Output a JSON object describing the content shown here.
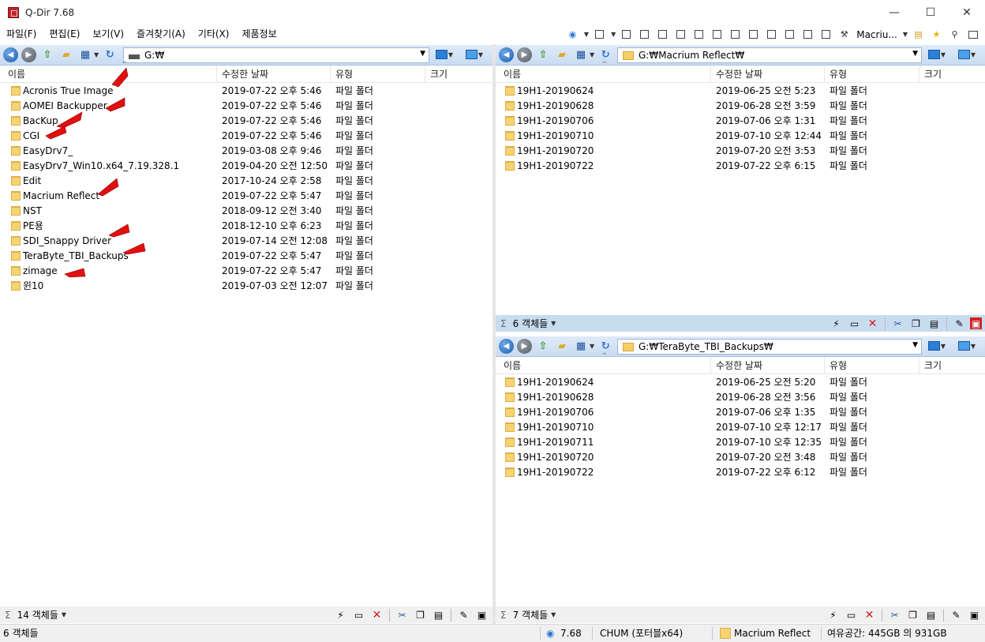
{
  "window": {
    "title": "Q-Dir 7.68"
  },
  "menu": [
    "파일(F)",
    "편집(E)",
    "보기(V)",
    "즐겨찾기(A)",
    "기타(X)",
    "제품정보"
  ],
  "toolbar_right": {
    "macro_label": "Macriu..."
  },
  "columns": {
    "name": "이름",
    "modified": "수정한 날짜",
    "type": "유형",
    "size": "크기"
  },
  "left_pane": {
    "path": "G:₩",
    "rows": [
      {
        "name": "Acronis True Image",
        "date": "2019-07-22 오후 5:46",
        "type": "파일 폴더"
      },
      {
        "name": "AOMEI Backupper",
        "date": "2019-07-22 오후 5:46",
        "type": "파일 폴더"
      },
      {
        "name": "BacKup",
        "date": "2019-07-22 오후 5:46",
        "type": "파일 폴더"
      },
      {
        "name": "CGI",
        "date": "2019-07-22 오후 5:46",
        "type": "파일 폴더"
      },
      {
        "name": "EasyDrv7_",
        "date": "2019-03-08 오후 9:46",
        "type": "파일 폴더"
      },
      {
        "name": "EasyDrv7_Win10.x64_7.19.328.1",
        "date": "2019-04-20 오전 12:50",
        "type": "파일 폴더"
      },
      {
        "name": "Edit",
        "date": "2017-10-24 오후 2:58",
        "type": "파일 폴더"
      },
      {
        "name": "Macrium Reflect",
        "date": "2019-07-22 오후 5:47",
        "type": "파일 폴더"
      },
      {
        "name": "NST",
        "date": "2018-09-12 오전 3:40",
        "type": "파일 폴더"
      },
      {
        "name": "PE용",
        "date": "2018-12-10 오후 6:23",
        "type": "파일 폴더"
      },
      {
        "name": "SDI_Snappy Driver",
        "date": "2019-07-14 오전 12:08",
        "type": "파일 폴더"
      },
      {
        "name": "TeraByte_TBI_Backups",
        "date": "2019-07-22 오후 5:47",
        "type": "파일 폴더"
      },
      {
        "name": "zimage",
        "date": "2019-07-22 오후 5:47",
        "type": "파일 폴더"
      },
      {
        "name": "윈10",
        "date": "2019-07-03 오전 12:07",
        "type": "파일 폴더"
      }
    ],
    "status": "14 객체들"
  },
  "right_top_pane": {
    "path": "G:₩Macrium Reflect₩",
    "rows": [
      {
        "name": "19H1-20190624",
        "date": "2019-06-25 오전 5:23",
        "type": "파일 폴더"
      },
      {
        "name": "19H1-20190628",
        "date": "2019-06-28 오전 3:59",
        "type": "파일 폴더"
      },
      {
        "name": "19H1-20190706",
        "date": "2019-07-06 오후 1:31",
        "type": "파일 폴더"
      },
      {
        "name": "19H1-20190710",
        "date": "2019-07-10 오후 12:44",
        "type": "파일 폴더"
      },
      {
        "name": "19H1-20190720",
        "date": "2019-07-20 오전 3:53",
        "type": "파일 폴더"
      },
      {
        "name": "19H1-20190722",
        "date": "2019-07-22 오후 6:15",
        "type": "파일 폴더"
      }
    ],
    "status": "6 객체들"
  },
  "right_bottom_pane": {
    "path": "G:₩TeraByte_TBI_Backups₩",
    "rows": [
      {
        "name": "19H1-20190624",
        "date": "2019-06-25 오전 5:20",
        "type": "파일 폴더"
      },
      {
        "name": "19H1-20190628",
        "date": "2019-06-28 오전 3:56",
        "type": "파일 폴더"
      },
      {
        "name": "19H1-20190706",
        "date": "2019-07-06 오후 1:35",
        "type": "파일 폴더"
      },
      {
        "name": "19H1-20190710",
        "date": "2019-07-10 오후 12:17",
        "type": "파일 폴더"
      },
      {
        "name": "19H1-20190711",
        "date": "2019-07-10 오후 12:35",
        "type": "파일 폴더"
      },
      {
        "name": "19H1-20190720",
        "date": "2019-07-20 오전 3:48",
        "type": "파일 폴더"
      },
      {
        "name": "19H1-20190722",
        "date": "2019-07-22 오후 6:12",
        "type": "파일 폴더"
      }
    ],
    "status": "7 객체들"
  },
  "bottom_status": {
    "objects": "6 객체들",
    "version": "7.68",
    "build": "CHUM (포터블x64)",
    "folder": "Macrium Reflect",
    "free_space": "여유공간: 445GB 의 931GB"
  },
  "colors": {
    "toolbar_blue": "#c9dcf2",
    "folder_yellow": "#f7d372",
    "annotation_red": "#e01010"
  }
}
